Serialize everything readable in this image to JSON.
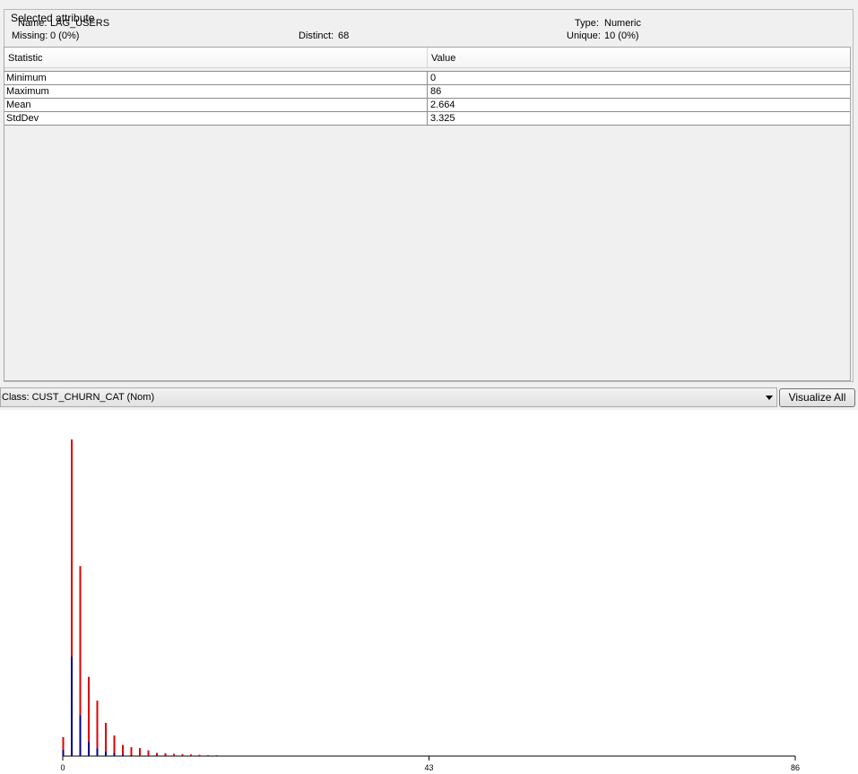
{
  "attribute": {
    "group_title": "Selected attribute",
    "name_label": "Name:",
    "name_value": "LAG_USERS",
    "type_label": "Type:",
    "type_value": "Numeric",
    "missing_label": "Missing:",
    "missing_value": "0 (0%)",
    "distinct_label": "Distinct:",
    "distinct_value": "68",
    "unique_label": "Unique:",
    "unique_value": "10 (0%)"
  },
  "stats_table": {
    "headers": [
      "Statistic",
      "Value"
    ],
    "rows": [
      {
        "statistic": "Minimum",
        "value": "0"
      },
      {
        "statistic": "Maximum",
        "value": "86"
      },
      {
        "statistic": "Mean",
        "value": "2.664"
      },
      {
        "statistic": "StdDev",
        "value": "3.325"
      }
    ]
  },
  "class_selector": {
    "selected": "Class: CUST_CHURN_CAT (Nom)"
  },
  "visualize_button": {
    "label": "Visualize All"
  },
  "colors": {
    "class_red": "#e00000",
    "class_blue": "#00008c"
  },
  "chart_data": {
    "type": "bar",
    "xlim": [
      0,
      86
    ],
    "tick_labels": [
      "0",
      "43",
      "86"
    ],
    "tick_values": [
      0,
      43,
      86
    ],
    "ylim": [
      0,
      1000
    ],
    "series": [],
    "bins": [
      {
        "x": 0,
        "red": 60,
        "blue": 20
      },
      {
        "x": 1,
        "red": 1000,
        "blue": 315
      },
      {
        "x": 2,
        "red": 600,
        "blue": 130
      },
      {
        "x": 3,
        "red": 250,
        "blue": 45
      },
      {
        "x": 4,
        "red": 175,
        "blue": 25
      },
      {
        "x": 5,
        "red": 105,
        "blue": 15
      },
      {
        "x": 6,
        "red": 65,
        "blue": 10
      },
      {
        "x": 7,
        "red": 35,
        "blue": 5
      },
      {
        "x": 8,
        "red": 28,
        "blue": 3
      },
      {
        "x": 9,
        "red": 25,
        "blue": 2
      },
      {
        "x": 10,
        "red": 18,
        "blue": 2
      },
      {
        "x": 11,
        "red": 10,
        "blue": 1
      },
      {
        "x": 12,
        "red": 9,
        "blue": 1
      },
      {
        "x": 13,
        "red": 7,
        "blue": 0
      },
      {
        "x": 14,
        "red": 6,
        "blue": 0
      },
      {
        "x": 15,
        "red": 5,
        "blue": 0
      },
      {
        "x": 16,
        "red": 4,
        "blue": 0
      },
      {
        "x": 17,
        "red": 3,
        "blue": 0
      },
      {
        "x": 18,
        "red": 3,
        "blue": 0
      },
      {
        "x": 22,
        "red": 2,
        "blue": 0
      }
    ]
  }
}
